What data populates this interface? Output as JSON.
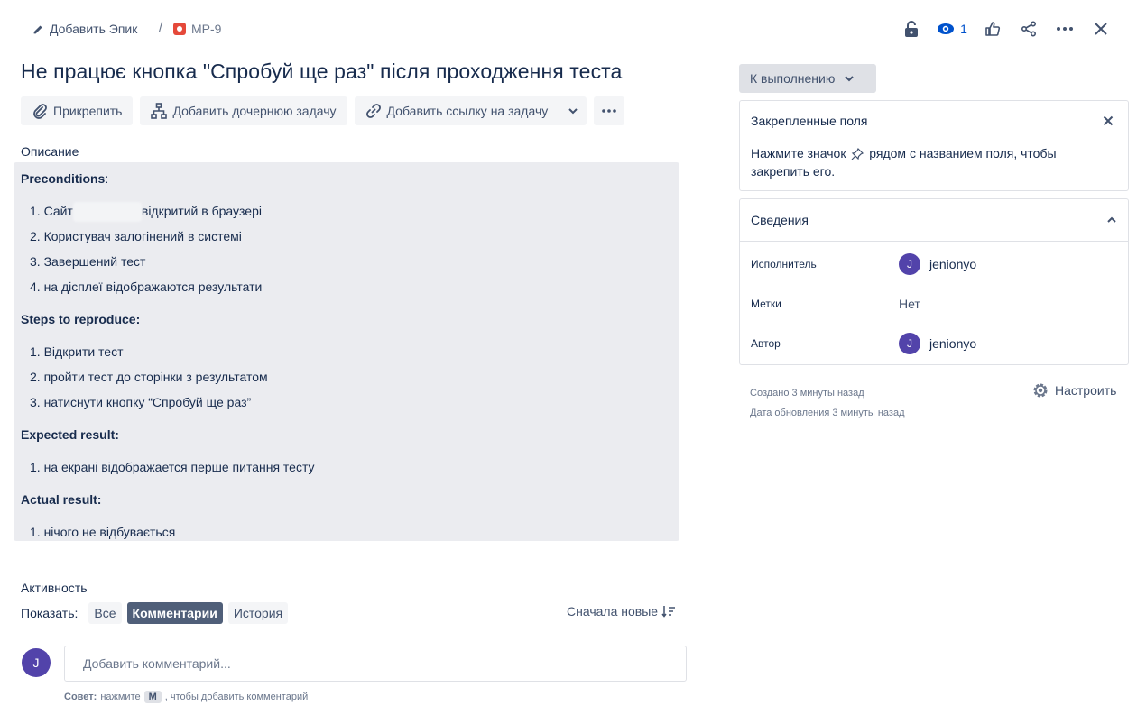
{
  "breadcrumb": {
    "add_epic_label": "Добавить Эпик",
    "separator": "/",
    "issue_key": "MP-9",
    "issue_type_icon": "bug-icon"
  },
  "toolbar": {
    "lock_icon": "lock-open-icon",
    "watch_icon": "eye-icon",
    "watch_count": "1",
    "like_icon": "thumbs-up-icon",
    "share_icon": "share-icon",
    "more_icon": "more-icon",
    "close_icon": "close-icon"
  },
  "issue": {
    "title": "Не працює кнопка \"Спробуй ще раз\" після проходження теста"
  },
  "actions": {
    "attach_label": "Прикрепить",
    "add_child_label": "Добавить дочернюю задачу",
    "add_link_label": "Добавить ссылку на задачу"
  },
  "description": {
    "label": "Описание",
    "preconditions_heading": "Preconditions",
    "preconditions_colon": ":",
    "preconditions": [
      {
        "num": "1.",
        "before": "Сайт",
        "after": "відкритий в браузері"
      },
      {
        "num": "2.",
        "text": "Користувач залогінений в системі"
      },
      {
        "num": "3.",
        "text": "Завершений тест"
      },
      {
        "num": "4.",
        "text": "на дісплеї відображаются результати"
      }
    ],
    "steps_heading": "Steps to reproduce:",
    "steps": [
      {
        "num": "1.",
        "text": "Відкрити тест"
      },
      {
        "num": "2.",
        "text": "пройти тест до сторінки з результатом"
      },
      {
        "num": "3.",
        "text": "натиснути кнопку “Спробуй ще раз”"
      }
    ],
    "expected_heading": "Expected result:",
    "expected": [
      {
        "num": "1.",
        "text": "на екрані відображается перше питання тесту"
      }
    ],
    "actual_heading": "Actual result:",
    "actual": [
      {
        "num": "1.",
        "text": "нічого не відбувається"
      }
    ]
  },
  "activity": {
    "label": "Активность",
    "show_label": "Показать:",
    "filters": [
      "Все",
      "Комментарии",
      "История"
    ],
    "active_filter": "Комментарии",
    "sort_label": "Сначала новые",
    "comment_placeholder": "Добавить комментарий...",
    "tip_prefix": "Совет:",
    "tip_mid": "нажмите",
    "tip_key": "M",
    "tip_suffix": ", чтобы добавить комментарий",
    "avatar_initial": "J"
  },
  "sidebar": {
    "status_label": "К выполнению",
    "pinned": {
      "title": "Закрепленные поля",
      "text_before": "Нажмите значок",
      "text_after": "рядом с названием поля, чтобы закрепить его."
    },
    "details": {
      "title": "Сведения",
      "assignee_label": "Исполнитель",
      "assignee_name": "jenionyo",
      "labels_label": "Метки",
      "labels_value": "Нет",
      "reporter_label": "Автор",
      "reporter_name": "jenionyo",
      "avatar_initial": "J",
      "avatar_color": "#5243aa"
    },
    "created": "Создано 3 минуты назад",
    "updated": "Дата обновления 3 минуты назад",
    "configure_label": "Настроить"
  },
  "colors": {
    "text": "#172b4d",
    "subtle": "#42526e",
    "muted": "#6b778c",
    "link": "#0052cc",
    "description_bg": "#ebecf0",
    "active_filter_bg": "#505f79",
    "bug": "#e5493a"
  }
}
